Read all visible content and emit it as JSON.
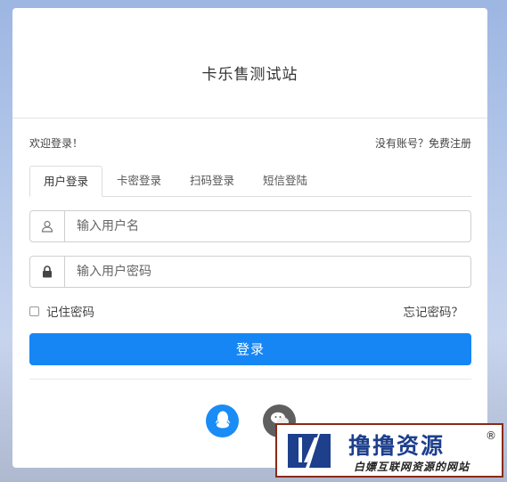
{
  "site": {
    "title": "卡乐售测试站",
    "welcome": "欢迎登录！",
    "register_link": "没有账号？免费注册"
  },
  "tabs": [
    {
      "label": "用户登录",
      "active": true
    },
    {
      "label": "卡密登录",
      "active": false
    },
    {
      "label": "扫码登录",
      "active": false
    },
    {
      "label": "短信登陆",
      "active": false
    }
  ],
  "form": {
    "username_placeholder": "输入用户名",
    "password_placeholder": "输入用户密码",
    "remember_label": "记住密码",
    "remember_checked": false,
    "forgot_label": "忘记密码？",
    "login_label": "登录"
  },
  "social": {
    "icons": [
      "qq-icon",
      "wechat-icon"
    ]
  },
  "watermark": {
    "main_text": "撸撸资源",
    "registered": "®",
    "sub_text": "白嫖互联网资源的网站"
  },
  "colors": {
    "primary": "#1686f5",
    "qq": "#1a8cf5",
    "wechat": "#5f5f5f"
  }
}
